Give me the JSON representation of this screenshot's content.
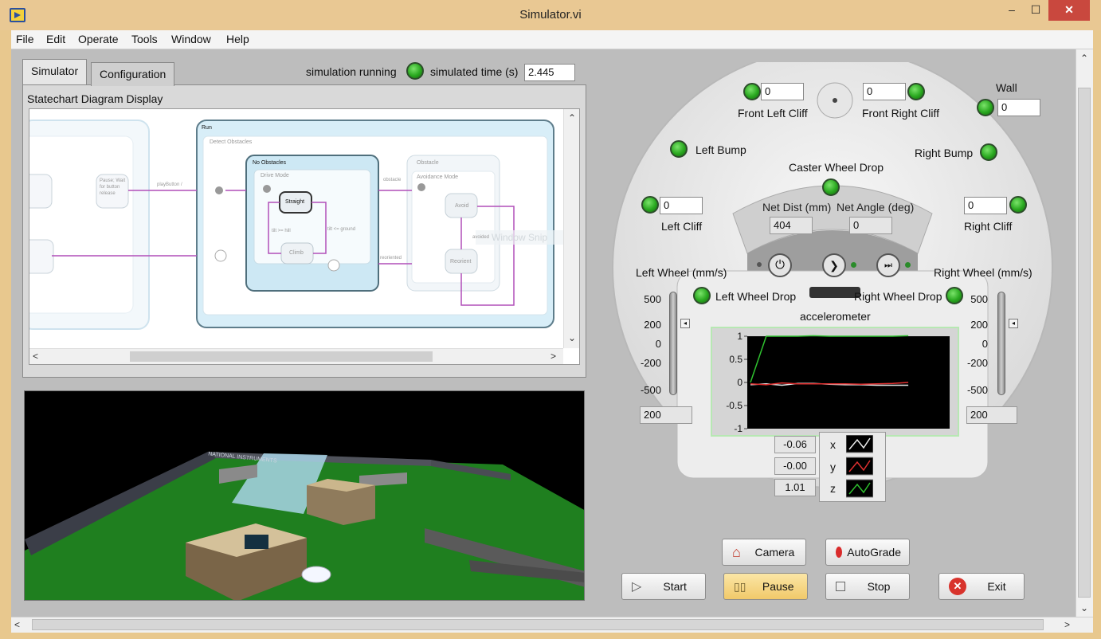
{
  "window": {
    "title": "Simulator.vi",
    "minimize": "–",
    "maximize": "☐",
    "close": "✕"
  },
  "menu": [
    "File",
    "Edit",
    "Operate",
    "Tools",
    "Window",
    "Help"
  ],
  "tabs": [
    "Simulator",
    "Configuration"
  ],
  "status": {
    "running_label": "simulation running",
    "time_label": "simulated time (s)",
    "time_value": "2.445"
  },
  "statechart": {
    "title": "Statechart Diagram Display",
    "run_label": "Run",
    "detect_label": "Detect Obstacles",
    "no_obstacles_label": "No Obstacles",
    "drive_mode_label": "Drive Mode",
    "straight_label": "Straight",
    "climb_label": "Climb",
    "obstacle_label": "Obstacle",
    "avoidance_label": "Avoidance Mode",
    "avoid_label": "Avoid",
    "reorient_label": "Reorient",
    "pause_label": "Pause; Wait for button release",
    "playbutton_label": "playButton /",
    "tilt_hill": "tilt >= hill",
    "tilt_ground": "tilt <= ground",
    "obstacle_edge": "obstacle",
    "reoriented_edge": "reoriented",
    "avoided_edge": "avoided",
    "ghost_text": "Window Snip"
  },
  "robot": {
    "front_left_cliff_label": "Front Left Cliff",
    "front_left_cliff_value": "0",
    "front_right_cliff_label": "Front Right Cliff",
    "front_right_cliff_value": "0",
    "wall_label": "Wall",
    "wall_value": "0",
    "left_bump_label": "Left Bump",
    "right_bump_label": "Right Bump",
    "caster_label": "Caster Wheel Drop",
    "left_cliff_label": "Left Cliff",
    "left_cliff_value": "0",
    "right_cliff_label": "Right Cliff",
    "right_cliff_value": "0",
    "net_dist_label": "Net Dist (mm)",
    "net_dist_value": "404",
    "net_angle_label": "Net Angle (deg)",
    "net_angle_value": "0",
    "left_wheel_label": "Left Wheel (mm/s)",
    "right_wheel_label": "Right Wheel (mm/s)",
    "left_wheel_drop_label": "Left Wheel Drop",
    "right_wheel_drop_label": "Right Wheel Drop",
    "left_wheel_value": "200",
    "right_wheel_value": "200",
    "wheel_ticks": [
      "500",
      "200",
      "0",
      "-200",
      "-500"
    ],
    "accelerometer_label": "accelerometer",
    "accel_x_value": "-0.06",
    "accel_y_value": "-0.00",
    "accel_z_value": "1.01",
    "legend": [
      "x",
      "y",
      "z"
    ]
  },
  "chart_data": {
    "type": "line",
    "title": "accelerometer",
    "ylim": [
      -1,
      1
    ],
    "yticks": [
      "1",
      "0.5",
      "0",
      "-0.5",
      "-1"
    ],
    "series": [
      {
        "name": "x",
        "color": "#e8e8e8",
        "values": [
          -0.05,
          -0.03,
          -0.06,
          -0.02,
          -0.02,
          -0.04,
          -0.05,
          -0.05,
          -0.06,
          -0.06,
          -0.06
        ]
      },
      {
        "name": "y",
        "color": "#e03030",
        "values": [
          -0.03,
          -0.05,
          -0.01,
          -0.03,
          -0.03,
          -0.03,
          -0.03,
          -0.04,
          -0.03,
          -0.02,
          0.0
        ]
      },
      {
        "name": "z",
        "color": "#2fc12f",
        "values": [
          0.0,
          1.0,
          1.0,
          1.0,
          1.01,
          1.0,
          1.0,
          1.0,
          1.0,
          1.0,
          1.01
        ]
      }
    ]
  },
  "buttons": {
    "camera": "Camera",
    "autograde": "AutoGrade",
    "start": "Start",
    "pause": "Pause",
    "stop": "Stop",
    "exit": "Exit"
  },
  "scene": {
    "banner_text": "NATIONAL INSTRUMENTS"
  }
}
